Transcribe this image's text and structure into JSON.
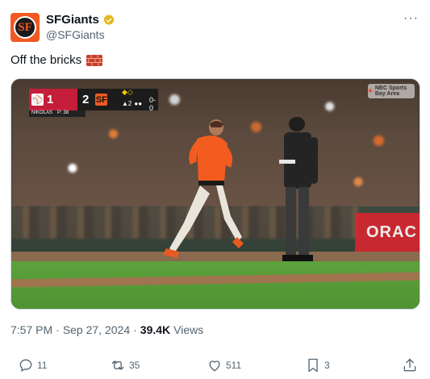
{
  "account": {
    "display_name": "SFGiants",
    "handle": "@SFGiants",
    "avatar_icon": "sf-giants-logo",
    "avatar_letters": "SF",
    "verified_color": "#e2b719"
  },
  "menu": {
    "more_label": "···"
  },
  "tweet": {
    "text": "Off the bricks",
    "emoji_icon": "brick-icon"
  },
  "video": {
    "scorebug": {
      "away_logo": "STL",
      "away_score": "1",
      "home_score": "2",
      "home_logo": "SF",
      "inning": "▲2",
      "count": "0-0",
      "pitcher_label": "NIKOLAS",
      "pitch_count": "P: 38"
    },
    "network_label": "NBC Sports Bay Area",
    "ad_text": "ORAC"
  },
  "meta": {
    "time": "7:57 PM",
    "separator": "·",
    "date": "Sep 27, 2024",
    "separator2": "·",
    "views": "39.4K",
    "views_label": "Views"
  },
  "actions": {
    "reply_count": "11",
    "retweet_count": "35",
    "like_count": "511",
    "bookmark_count": "3"
  },
  "colors": {
    "text": "#0f1419",
    "secondary": "#536471",
    "giants_orange": "#f05a22",
    "cardinals_red": "#c41e3a"
  }
}
